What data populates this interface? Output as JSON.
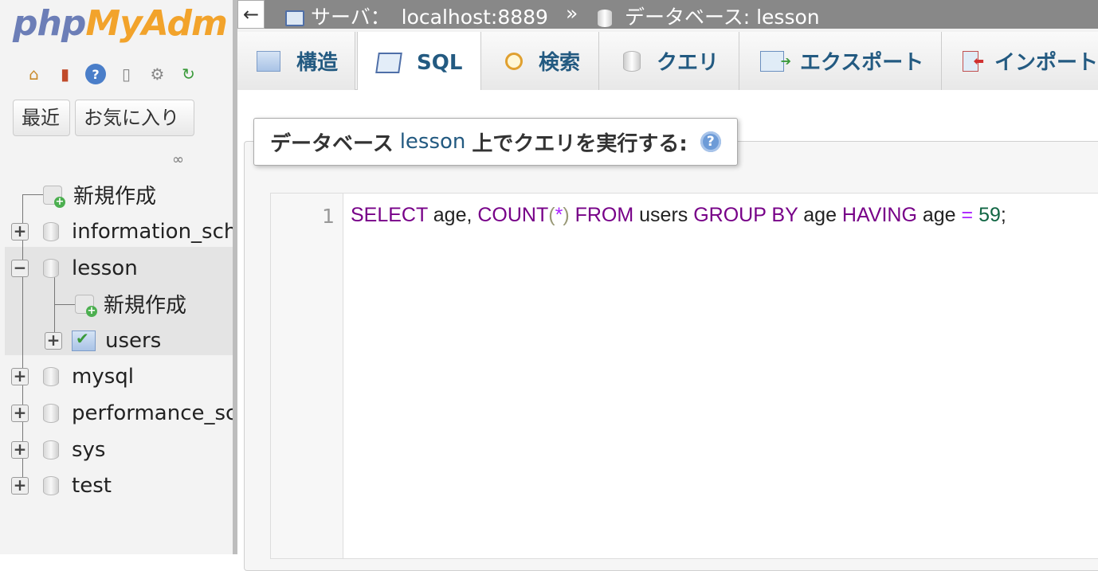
{
  "nav": {
    "logo_php": "php",
    "logo_my": "MyAdm",
    "icons": [
      "home-icon",
      "exit-icon",
      "help-icon",
      "docs-icon",
      "settings-icon",
      "reload-icon"
    ],
    "recent_label": "最近",
    "favorites_label": "お気に入り",
    "tree": {
      "new_root": "新規作成",
      "dbs": [
        "information_sch",
        "lesson",
        "mysql",
        "performance_sc",
        "sys",
        "test"
      ],
      "lesson_children": {
        "new": "新規作成",
        "table": "users"
      }
    }
  },
  "topbar": {
    "back": "←",
    "server_label": "サーバ：",
    "server_value": "localhost:8889",
    "separator": "»",
    "db_label": "データベース:",
    "db_value": "lesson"
  },
  "tabs": [
    {
      "label": "構造"
    },
    {
      "label": "SQL"
    },
    {
      "label": "検索"
    },
    {
      "label": "クエリ"
    },
    {
      "label": "エクスポート"
    },
    {
      "label": "インポート"
    }
  ],
  "query": {
    "legend_prefix": "データベース",
    "legend_db": "lesson",
    "legend_suffix": "上でクエリを実行する:",
    "line_number": "1",
    "tokens": {
      "select": "SELECT",
      "t1": " age, ",
      "count": "COUNT",
      "lp": "(",
      "star": "*",
      "rp": ")",
      "from": " FROM",
      "t2": " users ",
      "groupby": "GROUP BY",
      "t3": " age ",
      "having": "HAVING",
      "t4": " age ",
      "eq": "=",
      "sp": " ",
      "num": "59",
      "semi": ";"
    }
  }
}
